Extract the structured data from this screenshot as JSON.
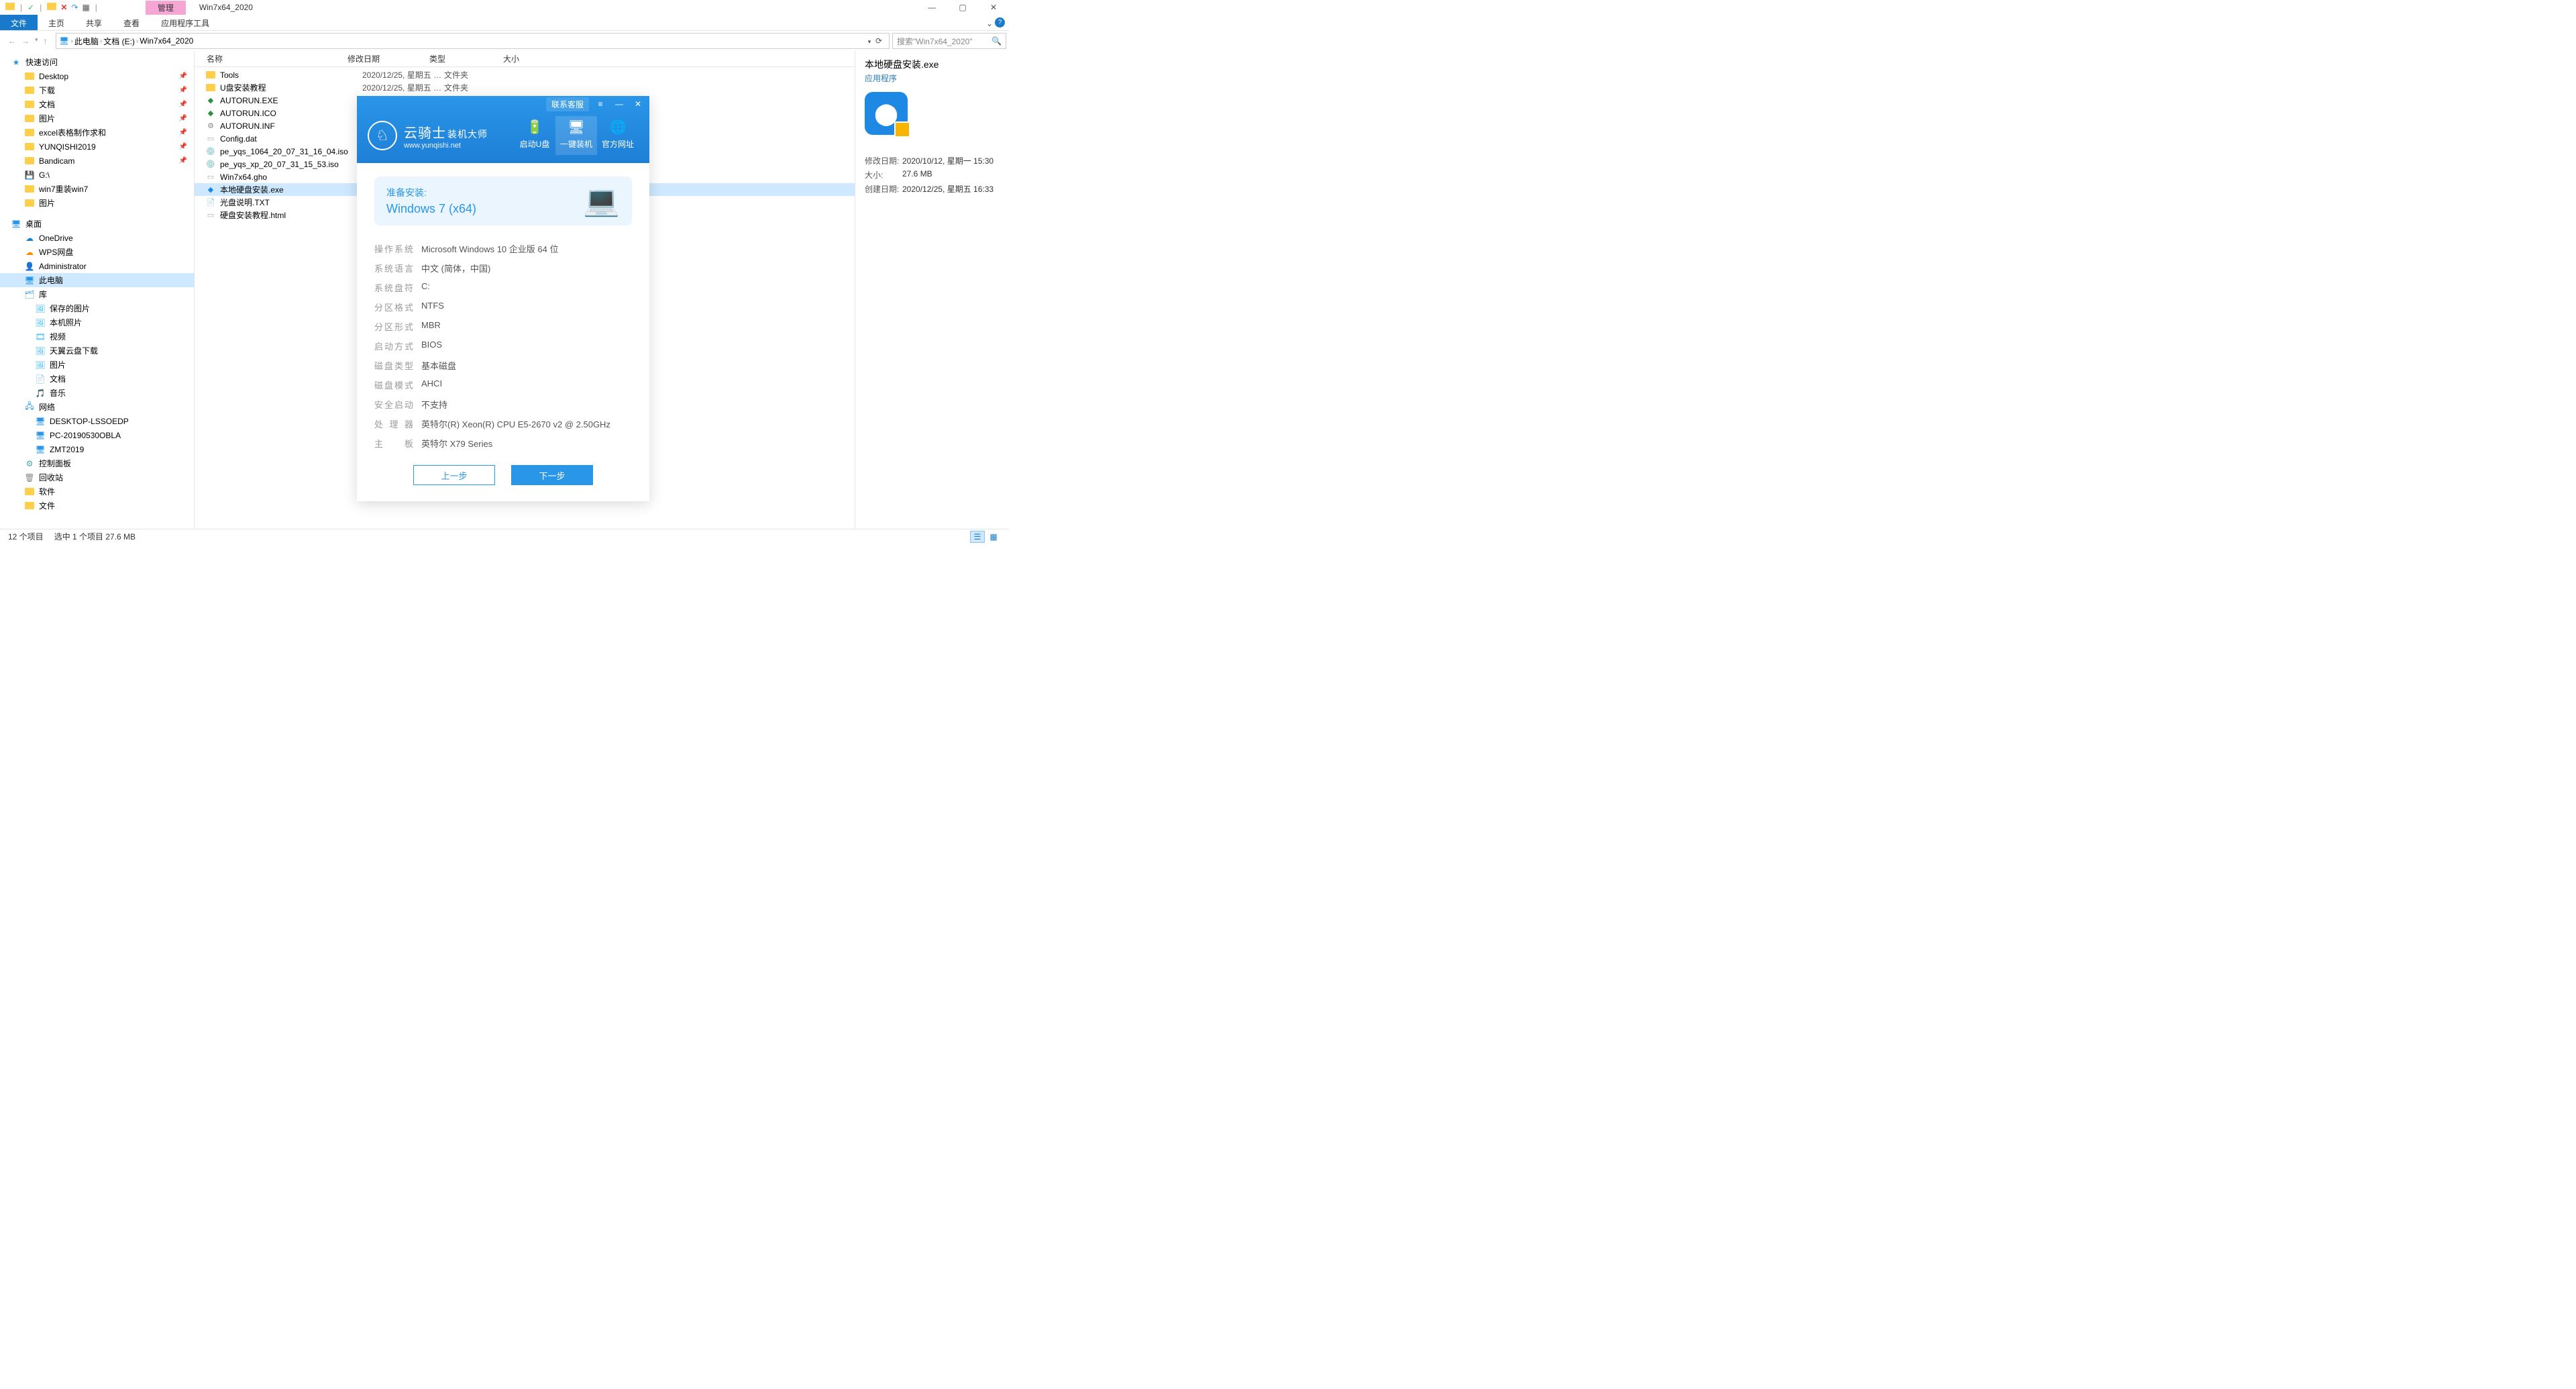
{
  "window": {
    "context_tab": "管理",
    "title": "Win7x64_2020",
    "help_badge": "?"
  },
  "ribbon": {
    "file": "文件",
    "tabs": [
      "主页",
      "共享",
      "查看",
      "应用程序工具"
    ]
  },
  "breadcrumb": {
    "segments": [
      "此电脑",
      "文档 (E:)",
      "Win7x64_2020"
    ]
  },
  "search": {
    "placeholder": "搜索\"Win7x64_2020\""
  },
  "nav": {
    "quick_access": "快速访问",
    "quick_items": [
      {
        "label": "Desktop",
        "pin": true
      },
      {
        "label": "下载",
        "pin": true
      },
      {
        "label": "文档",
        "pin": true
      },
      {
        "label": "图片",
        "pin": true
      },
      {
        "label": "excel表格制作求和",
        "pin": true
      },
      {
        "label": "YUNQISHI2019",
        "pin": true
      },
      {
        "label": "Bandicam",
        "pin": true
      },
      {
        "label": "G:\\"
      },
      {
        "label": "win7重装win7"
      },
      {
        "label": "图片"
      }
    ],
    "desktop": "桌面",
    "desktop_items": [
      "OneDrive",
      "WPS网盘",
      "Administrator",
      "此电脑",
      "库"
    ],
    "lib_items": [
      "保存的图片",
      "本机照片",
      "视频",
      "天翼云盘下载",
      "图片",
      "文档",
      "音乐"
    ],
    "network": "网络",
    "network_items": [
      "DESKTOP-LSSOEDP",
      "PC-20190530OBLA",
      "ZMT2019"
    ],
    "control_panel": "控制面板",
    "recycle": "回收站",
    "software": "软件",
    "files": "文件"
  },
  "columns": {
    "name": "名称",
    "date": "修改日期",
    "type": "类型",
    "size": "大小"
  },
  "files": [
    {
      "name": "Tools",
      "date": "2020/12/25, 星期五 1...",
      "type": "文件夹",
      "icon": "folder"
    },
    {
      "name": "U盘安装教程",
      "date": "2020/12/25, 星期五 1...",
      "type": "文件夹",
      "icon": "folder"
    },
    {
      "name": "AUTORUN.EXE",
      "date": "",
      "type": "",
      "icon": "exe-green"
    },
    {
      "name": "AUTORUN.ICO",
      "date": "",
      "type": "",
      "icon": "ico-green"
    },
    {
      "name": "AUTORUN.INF",
      "date": "",
      "type": "",
      "icon": "inf"
    },
    {
      "name": "Config.dat",
      "date": "",
      "type": "",
      "icon": "dat"
    },
    {
      "name": "pe_yqs_1064_20_07_31_16_04.iso",
      "date": "",
      "type": "",
      "icon": "iso"
    },
    {
      "name": "pe_yqs_xp_20_07_31_15_53.iso",
      "date": "",
      "type": "",
      "icon": "iso"
    },
    {
      "name": "Win7x64.gho",
      "date": "",
      "type": "",
      "icon": "gho"
    },
    {
      "name": "本地硬盘安装.exe",
      "date": "",
      "type": "",
      "icon": "exe-blue",
      "selected": true
    },
    {
      "name": "光盘说明.TXT",
      "date": "",
      "type": "",
      "icon": "txt"
    },
    {
      "name": "硬盘安装教程.html",
      "date": "",
      "type": "",
      "icon": "html"
    }
  ],
  "details": {
    "title": "本地硬盘安装.exe",
    "subtitle": "应用程序",
    "rows": [
      {
        "label": "修改日期:",
        "value": "2020/10/12, 星期一 15:30"
      },
      {
        "label": "大小:",
        "value": "27.6 MB"
      },
      {
        "label": "创建日期:",
        "value": "2020/12/25, 星期五 16:33"
      }
    ]
  },
  "status": {
    "count": "12 个项目",
    "selected": "选中 1 个项目  27.6 MB"
  },
  "yqs": {
    "contact": "联系客服",
    "brand": "云骑士",
    "brand_sub": "装机大师",
    "url": "www.yunqishi.net",
    "nav": [
      {
        "label": "启动U盘",
        "icon": "🔋"
      },
      {
        "label": "一键装机",
        "icon": "🖥",
        "active": true
      },
      {
        "label": "官方网址",
        "icon": "🌐"
      }
    ],
    "prepare_label": "准备安装:",
    "prepare_os": "Windows 7 (x64)",
    "info": [
      {
        "label": "操作系统",
        "value": "Microsoft Windows 10 企业版 64 位"
      },
      {
        "label": "系统语言",
        "value": "中文 (简体，中国)"
      },
      {
        "label": "系统盘符",
        "value": "C:"
      },
      {
        "label": "分区格式",
        "value": "NTFS"
      },
      {
        "label": "分区形式",
        "value": "MBR"
      },
      {
        "label": "启动方式",
        "value": "BIOS"
      },
      {
        "label": "磁盘类型",
        "value": "基本磁盘"
      },
      {
        "label": "磁盘模式",
        "value": "AHCI"
      },
      {
        "label": "安全启动",
        "value": "不支持"
      },
      {
        "label": "处理器",
        "value": "英特尔(R) Xeon(R) CPU E5-2670 v2 @ 2.50GHz"
      },
      {
        "label": "主板",
        "value": "英特尔 X79 Series"
      }
    ],
    "prev": "上一步",
    "next": "下一步"
  }
}
